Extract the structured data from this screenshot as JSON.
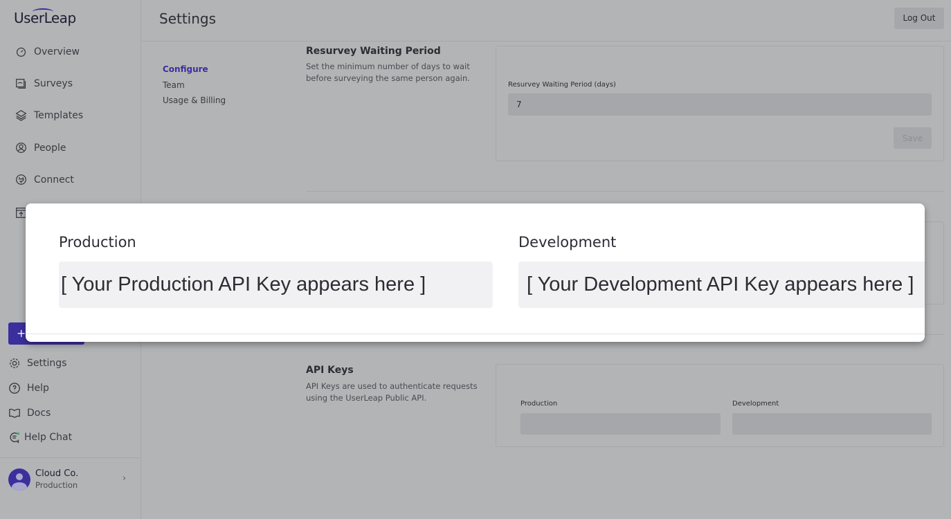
{
  "sidebar": {
    "logo": "UserLeap",
    "items": [
      {
        "label": "Overview",
        "icon": "gauge-icon"
      },
      {
        "label": "Surveys",
        "icon": "survey-icon"
      },
      {
        "label": "Templates",
        "icon": "layers-icon"
      },
      {
        "label": "People",
        "icon": "person-icon"
      },
      {
        "label": "Connect",
        "icon": "plug-icon"
      }
    ],
    "new_button": "+",
    "bottom": [
      {
        "label": "Settings",
        "icon": "gear-icon"
      },
      {
        "label": "Help",
        "icon": "question-icon"
      },
      {
        "label": "Docs",
        "icon": "book-icon"
      },
      {
        "label": "Help Chat",
        "icon": "chat-icon"
      }
    ],
    "account": {
      "name": "Cloud Co.",
      "env": "Production"
    }
  },
  "header": {
    "title": "Settings",
    "logout": "Log Out"
  },
  "subnav": [
    "Configure",
    "Team",
    "Usage & Billing"
  ],
  "accent": "#3b2f9e",
  "resurvey": {
    "title": "Resurvey Waiting Period",
    "desc": "Set the minimum number of days to wait before surveying the same person again.",
    "label": "Resurvey Waiting Period (days)",
    "value": "7",
    "save": "Save"
  },
  "api_keys": {
    "title": "API Keys",
    "desc": "API Keys are used to authenticate requests using the UserLeap Public API.",
    "production_label": "Production",
    "development_label": "Development"
  },
  "modal": {
    "production_label": "Production",
    "production_value": "[ Your Production API Key appears here ]",
    "development_label": "Development",
    "development_value": "[ Your Development API Key appears here ]"
  }
}
